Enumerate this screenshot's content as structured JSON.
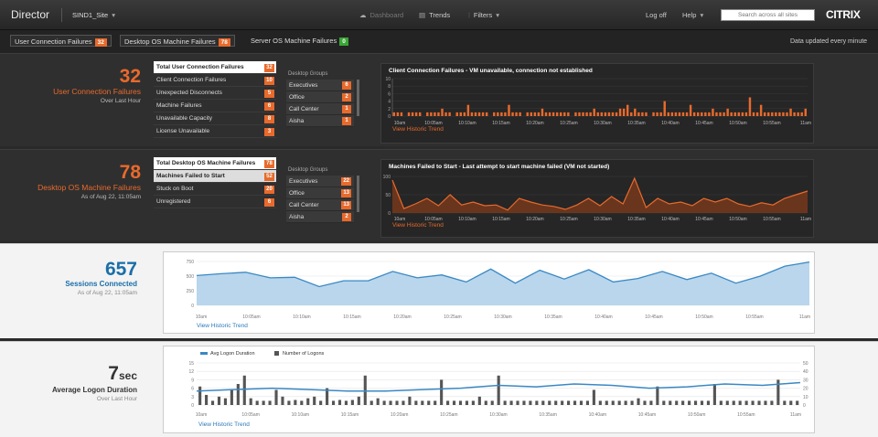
{
  "topbar": {
    "title": "Director",
    "site": "SIND1_Site",
    "nav": {
      "dashboard": "Dashboard",
      "trends": "Trends",
      "filters": "Filters"
    },
    "logoff": "Log off",
    "help": "Help",
    "search_placeholder": "Search across all sites",
    "logo": "CITRIX"
  },
  "filterbar": {
    "chips": [
      {
        "label": "User Connection Failures",
        "count": "32",
        "color": "#e86a2c"
      },
      {
        "label": "Desktop OS Machine Failures",
        "count": "78",
        "color": "#e86a2c"
      },
      {
        "label": "Server OS Machine Failures",
        "count": "0",
        "color": "#3aa536"
      }
    ],
    "updated": "Data updated every minute"
  },
  "ucf": {
    "count": "32",
    "title": "User Connection Failures",
    "sub": "Over Last Hour",
    "list": [
      {
        "label": "Total User Connection Failures",
        "count": "32"
      },
      {
        "label": "Client Connection Failures",
        "count": "10"
      },
      {
        "label": "Unexpected Disconnects",
        "count": "5"
      },
      {
        "label": "Machine Failures",
        "count": "6"
      },
      {
        "label": "Unavailable Capacity",
        "count": "8"
      },
      {
        "label": "License Unavailable",
        "count": "3"
      }
    ],
    "groups_title": "Desktop Groups",
    "groups": [
      {
        "label": "Executives",
        "count": "6"
      },
      {
        "label": "Office",
        "count": "2"
      },
      {
        "label": "Call Center",
        "count": "1"
      },
      {
        "label": "Aisha",
        "count": "1"
      }
    ],
    "chart": {
      "title": "Client Connection Failures - VM unavailable, connection not established",
      "link": "View Historic Trend",
      "yticks": [
        "10",
        "8",
        "6",
        "4",
        "2",
        "0"
      ],
      "xticks": [
        "10am",
        "10:05am",
        "10:10am",
        "10:15am",
        "10:20am",
        "10:25am",
        "10:30am",
        "10:35am",
        "10:40am",
        "10:45am",
        "10:50am",
        "10:55am",
        "11am"
      ],
      "values": [
        1,
        1,
        1,
        0,
        1,
        1,
        1,
        1,
        0,
        1,
        1,
        1,
        1,
        2,
        1,
        1,
        0,
        1,
        1,
        1,
        3,
        1,
        1,
        1,
        1,
        1,
        0,
        1,
        1,
        1,
        1,
        3,
        1,
        1,
        1,
        0,
        1,
        1,
        1,
        1,
        2,
        1,
        1,
        1,
        1,
        1,
        1,
        1,
        0,
        1,
        1,
        1,
        1,
        1,
        2,
        1,
        1,
        1,
        1,
        1,
        1,
        2,
        2,
        3,
        1,
        2,
        1,
        1,
        1,
        0,
        1,
        1,
        1,
        4,
        1,
        1,
        1,
        1,
        1,
        1,
        3,
        1,
        1,
        1,
        1,
        1,
        2,
        1,
        1,
        1,
        2,
        1,
        1,
        1,
        1,
        1,
        5,
        1,
        1,
        3,
        1,
        1,
        1,
        1,
        1,
        1,
        1,
        2,
        1,
        1,
        1,
        2
      ]
    }
  },
  "dof": {
    "count": "78",
    "title": "Desktop OS Machine Failures",
    "sub": "As of Aug 22, 11:05am",
    "list": [
      {
        "label": "Total Desktop OS Machine Failures",
        "count": "78"
      },
      {
        "label": "Machines Failed to Start",
        "count": "52"
      },
      {
        "label": "Stuck on Boot",
        "count": "20"
      },
      {
        "label": "Unregistered",
        "count": "6"
      }
    ],
    "groups_title": "Desktop Groups",
    "groups": [
      {
        "label": "Executives",
        "count": "22"
      },
      {
        "label": "Office",
        "count": "13"
      },
      {
        "label": "Call Center",
        "count": "13"
      },
      {
        "label": "Aisha",
        "count": "2"
      }
    ],
    "chart": {
      "title": "Machines Failed to Start - Last attempt to start machine failed (VM not started)",
      "link": "View Historic Trend",
      "yticks": [
        "100",
        "50",
        "0"
      ],
      "xticks": [
        "10am",
        "10:05am",
        "10:10am",
        "10:15am",
        "10:20am",
        "10:25am",
        "10:30am",
        "10:35am",
        "10:40am",
        "10:45am",
        "10:50am",
        "10:55am",
        "11am"
      ],
      "values": [
        90,
        12,
        25,
        40,
        20,
        50,
        22,
        30,
        20,
        22,
        8,
        40,
        30,
        22,
        18,
        10,
        22,
        40,
        20,
        45,
        25,
        95,
        15,
        40,
        25,
        30,
        20,
        40,
        30,
        40,
        25,
        18,
        28,
        22,
        40,
        50,
        60
      ]
    }
  },
  "sessions": {
    "count": "657",
    "title": "Sessions Connected",
    "sub": "As of Aug 22, 11:05am",
    "chart": {
      "link": "View Historic Trend",
      "yticks": [
        "750",
        "500",
        "250",
        "0"
      ],
      "xticks": [
        "10am",
        "10:05am",
        "10:10am",
        "10:15am",
        "10:20am",
        "10:25am",
        "10:30am",
        "10:35am",
        "10:40am",
        "10:45am",
        "10:50am",
        "10:55am",
        "11am"
      ],
      "values": [
        510,
        540,
        565,
        470,
        480,
        320,
        420,
        420,
        580,
        470,
        520,
        400,
        620,
        380,
        600,
        450,
        610,
        400,
        460,
        580,
        440,
        550,
        380,
        500,
        670,
        740
      ]
    }
  },
  "logon": {
    "count": "7",
    "unit": "sec",
    "title": "Average Logon Duration",
    "sub": "Over Last Hour",
    "chart": {
      "legend_line": "Avg Logon Duration",
      "legend_bar": "Number of Logons",
      "link": "View Historic Trend",
      "yticks_left": [
        "15",
        "12",
        "9",
        "6",
        "3",
        "0"
      ],
      "yticks_right": [
        "50",
        "40",
        "30",
        "20",
        "10",
        "0"
      ],
      "xticks": [
        "10am",
        "10:05am",
        "10:10am",
        "10:15am",
        "10:20am",
        "10:25am",
        "10:30am",
        "10:35am",
        "10:40am",
        "10:45am",
        "10:50am",
        "10:55am",
        "11am"
      ],
      "line_values": [
        5,
        5.5,
        6,
        5.5,
        5,
        5,
        5.5,
        6,
        7,
        6.5,
        7.5,
        7,
        6,
        6.5,
        7.5,
        7,
        8
      ],
      "bar_values": [
        22,
        12,
        5,
        10,
        8,
        18,
        25,
        35,
        8,
        5,
        5,
        5,
        18,
        10,
        5,
        6,
        5,
        8,
        10,
        5,
        20,
        5,
        6,
        5,
        6,
        10,
        35,
        5,
        8,
        5,
        5,
        5,
        5,
        10,
        5,
        5,
        5,
        5,
        30,
        5,
        5,
        5,
        5,
        5,
        10,
        5,
        5,
        35,
        5,
        5,
        5,
        5,
        5,
        5,
        5,
        5,
        5,
        5,
        5,
        5,
        5,
        5,
        18,
        5,
        5,
        5,
        5,
        5,
        5,
        8,
        5,
        5,
        22,
        5,
        5,
        5,
        5,
        5,
        5,
        5,
        5,
        25,
        5,
        5,
        5,
        5,
        5,
        5,
        5,
        5,
        5,
        30,
        5,
        5,
        5
      ]
    }
  },
  "colors": {
    "accent_orange": "#e86a2c",
    "accent_blue": "#1a6fa8",
    "ok_green": "#3aa536"
  }
}
